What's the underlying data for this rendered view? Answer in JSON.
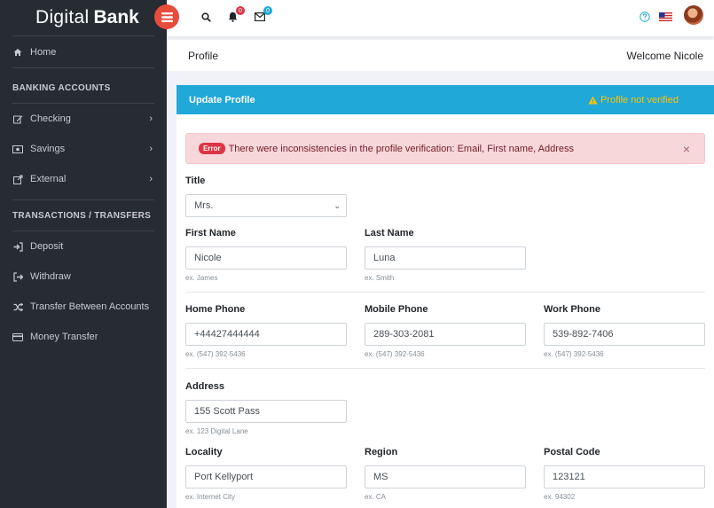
{
  "brand": {
    "part1": "Digital",
    "part2": "Bank"
  },
  "sidebar": {
    "home": "Home",
    "banking_heading": "BANKING ACCOUNTS",
    "checking": "Checking",
    "savings": "Savings",
    "external": "External",
    "transactions_heading": "TRANSACTIONS / TRANSFERS",
    "deposit": "Deposit",
    "withdraw": "Withdraw",
    "transfer_between": "Transfer Between Accounts",
    "money_transfer": "Money Transfer"
  },
  "header": {
    "notifications_count": "0",
    "messages_count": "0",
    "accent": "#e74c3c"
  },
  "page": {
    "title": "Profile",
    "welcome": "Welcome Nicole"
  },
  "card": {
    "title": "Update Profile",
    "status": "Profile not verified",
    "header_color": "#20a8d8"
  },
  "alert": {
    "badge": "Error",
    "message": "There were inconsistencies in the profile verification: Email, First name, Address",
    "close": "×"
  },
  "form": {
    "title": {
      "label": "Title",
      "value": "Mrs."
    },
    "first_name": {
      "label": "First Name",
      "value": "Nicole",
      "hint": "ex. James"
    },
    "last_name": {
      "label": "Last Name",
      "value": "Luna",
      "hint": "ex. Smith"
    },
    "home_phone": {
      "label": "Home Phone",
      "value": "+44427444444",
      "hint": "ex. (547) 392-5436"
    },
    "mobile_phone": {
      "label": "Mobile Phone",
      "value": "289-303-2081",
      "hint": "ex. (547) 392-5436"
    },
    "work_phone": {
      "label": "Work Phone",
      "value": "539-892-7406",
      "hint": "ex. (547) 392-5436"
    },
    "address": {
      "label": "Address",
      "value": "155 Scott Pass",
      "hint": "ex. 123 Digital Lane"
    },
    "locality": {
      "label": "Locality",
      "value": "Port Kellyport",
      "hint": "ex. Internet City"
    },
    "region": {
      "label": "Region",
      "value": "MS",
      "hint": "ex. CA"
    },
    "postal_code": {
      "label": "Postal Code",
      "value": "123121",
      "hint": "ex. 94302"
    }
  }
}
